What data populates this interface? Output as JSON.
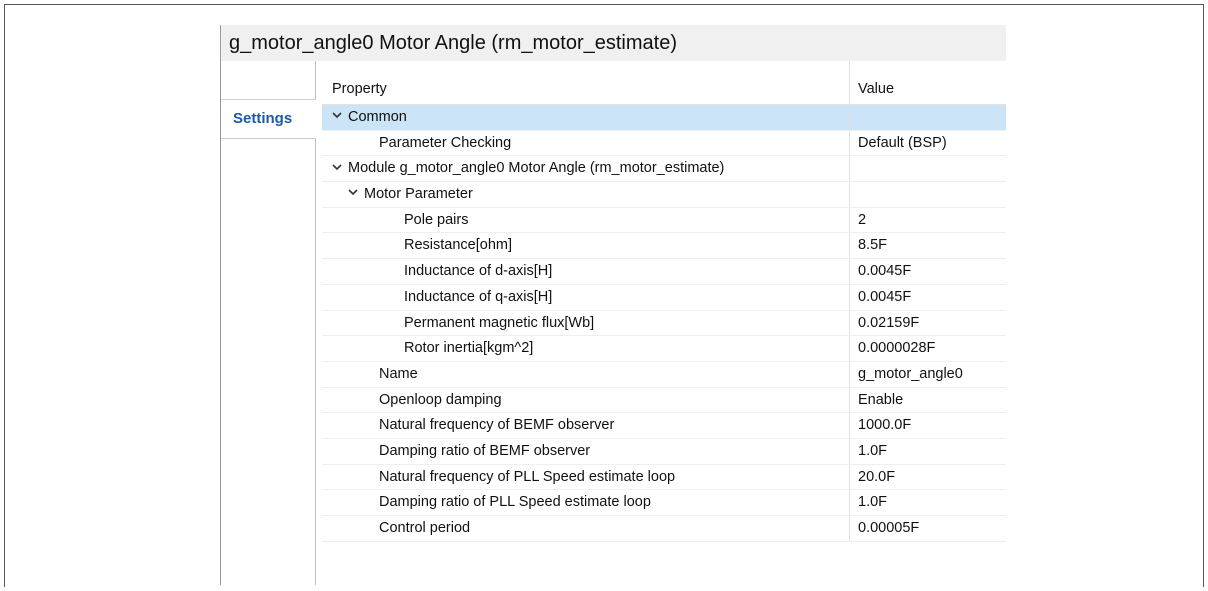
{
  "panel": {
    "title": "g_motor_angle0 Motor Angle (rm_motor_estimate)",
    "tabs": [
      {
        "label": "Settings",
        "active": true
      }
    ]
  },
  "grid": {
    "columns": {
      "property": "Property",
      "value": "Value"
    },
    "rows": [
      {
        "label": "Common",
        "value": "",
        "expandable": true,
        "selected": true
      },
      {
        "label": "Parameter Checking",
        "value": "Default (BSP)"
      },
      {
        "label": "Module g_motor_angle0 Motor Angle (rm_motor_estimate)",
        "value": "",
        "expandable": true
      },
      {
        "label": "Motor Parameter",
        "value": "",
        "expandable": true
      },
      {
        "label": "Pole pairs",
        "value": "2"
      },
      {
        "label": "Resistance[ohm]",
        "value": "8.5F"
      },
      {
        "label": "Inductance of d-axis[H]",
        "value": "0.0045F"
      },
      {
        "label": "Inductance of q-axis[H]",
        "value": "0.0045F"
      },
      {
        "label": "Permanent magnetic flux[Wb]",
        "value": "0.02159F"
      },
      {
        "label": "Rotor inertia[kgm^2]",
        "value": "0.0000028F"
      },
      {
        "label": "Name",
        "value": "g_motor_angle0"
      },
      {
        "label": "Openloop damping",
        "value": "Enable"
      },
      {
        "label": "Natural frequency of BEMF observer",
        "value": "1000.0F"
      },
      {
        "label": "Damping ratio of BEMF observer",
        "value": "1.0F"
      },
      {
        "label": "Natural frequency of PLL Speed estimate loop",
        "value": "20.0F"
      },
      {
        "label": "Damping ratio of PLL Speed estimate loop",
        "value": "1.0F"
      },
      {
        "label": "Control period",
        "value": "0.00005F"
      }
    ]
  }
}
